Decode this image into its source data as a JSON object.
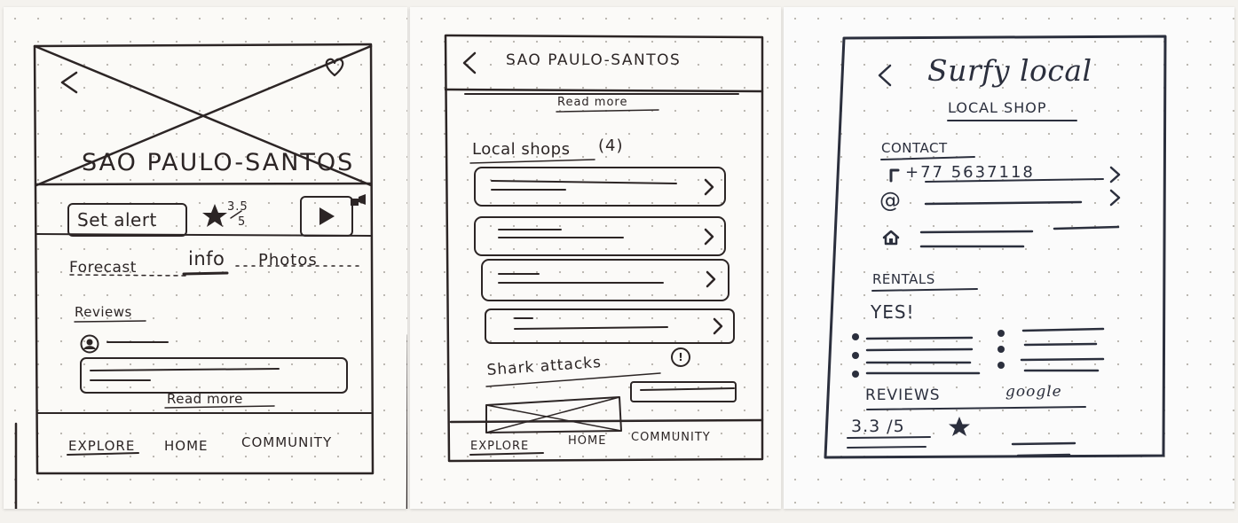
{
  "screen1": {
    "title": "SAO PAULO-SANTOS",
    "set_alert_label": "Set alert",
    "rating_top": "3.5",
    "rating_bottom": "5",
    "tabs": [
      "Forecast",
      "info",
      "Photos"
    ],
    "reviews_label": "Reviews",
    "read_more": "Read more",
    "nav": [
      "EXPLORE",
      "HOME",
      "COMMUNITY"
    ]
  },
  "screen2": {
    "title": "SAO PAULO-SANTOS",
    "read_more": "Read more",
    "local_shops_label": "Local shops",
    "local_shops_count": "(4)",
    "shark_attacks_label": "Shark attacks",
    "alert_symbol": "!",
    "nav": [
      "EXPLORE",
      "HOME",
      "COMMUNITY"
    ]
  },
  "screen3": {
    "title": "Surfy local",
    "subtitle": "LOCAL SHOP",
    "contact_label": "CONTACT",
    "phone": "+77 5637118",
    "email_symbol": "@",
    "rentals_label": "RENTALS",
    "rentals_value": "YES!",
    "reviews_label": "REVIEWS",
    "reviews_source": "google",
    "rating": "3.3 /5"
  },
  "icons": {
    "back": "chevron-left-icon",
    "favorite": "heart-icon",
    "star": "star-icon",
    "play": "play-icon",
    "chevron": "chevron-right-icon",
    "avatar": "avatar-icon",
    "home": "home-icon",
    "phone": "phone-icon"
  }
}
